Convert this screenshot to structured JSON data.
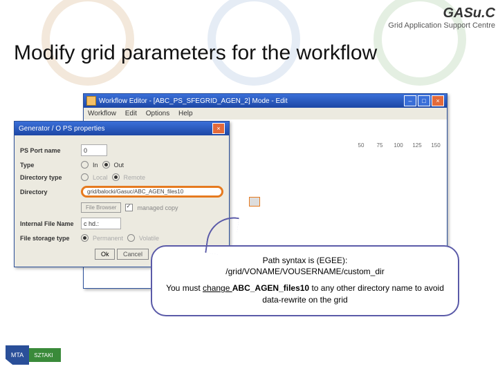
{
  "header": {
    "logo": "GASu.C",
    "tagline": "Grid Application Support Centre"
  },
  "slide": {
    "title": "Modify grid parameters for the workflow"
  },
  "editor": {
    "title": "Workflow Editor - [ABC_PS_SFEGRID_AGEN_2]  Mode - Edit",
    "menu": {
      "workflow": "Workflow",
      "edit": "Edit",
      "options": "Options",
      "help": "Help"
    },
    "ruler": {
      "t50": "50",
      "t75": "75",
      "t100": "100",
      "t125": "125",
      "t150": "150"
    }
  },
  "props": {
    "title": "Generator / O PS properties",
    "portname_label": "PS Port name",
    "portname_value": "0",
    "type_label": "Type",
    "type_in": "In",
    "type_out": "Out",
    "dirtype_label": "Directory type",
    "dirtype_local": "Local",
    "dirtype_remote": "Remote",
    "dir_label": "Directory",
    "dir_value": "grid/balocki/Gasuc/ABC_AGEN_files10",
    "filebrowser": "File Browser",
    "managed": "managed copy",
    "ifn_label": "Internal File Name",
    "ifn_value": "c hd.:",
    "fst_label": "File storage type",
    "fst_perm": "Permanent",
    "fst_vol": "Volatile",
    "ok": "Ok",
    "cancel": "Cancel"
  },
  "callout": {
    "line1": "Path syntax is (EGEE):",
    "line2": "/grid/VONAME/VOUSERNAME/custom_dir",
    "line3a": "You must ",
    "line3b": "change ",
    "line3c": "ABC_AGEN_files10",
    "line3d": " to any other directory name to avoid data-rewrite on the grid"
  },
  "footer": {
    "mta": "MTA",
    "sztaki": "SZTAKI"
  }
}
